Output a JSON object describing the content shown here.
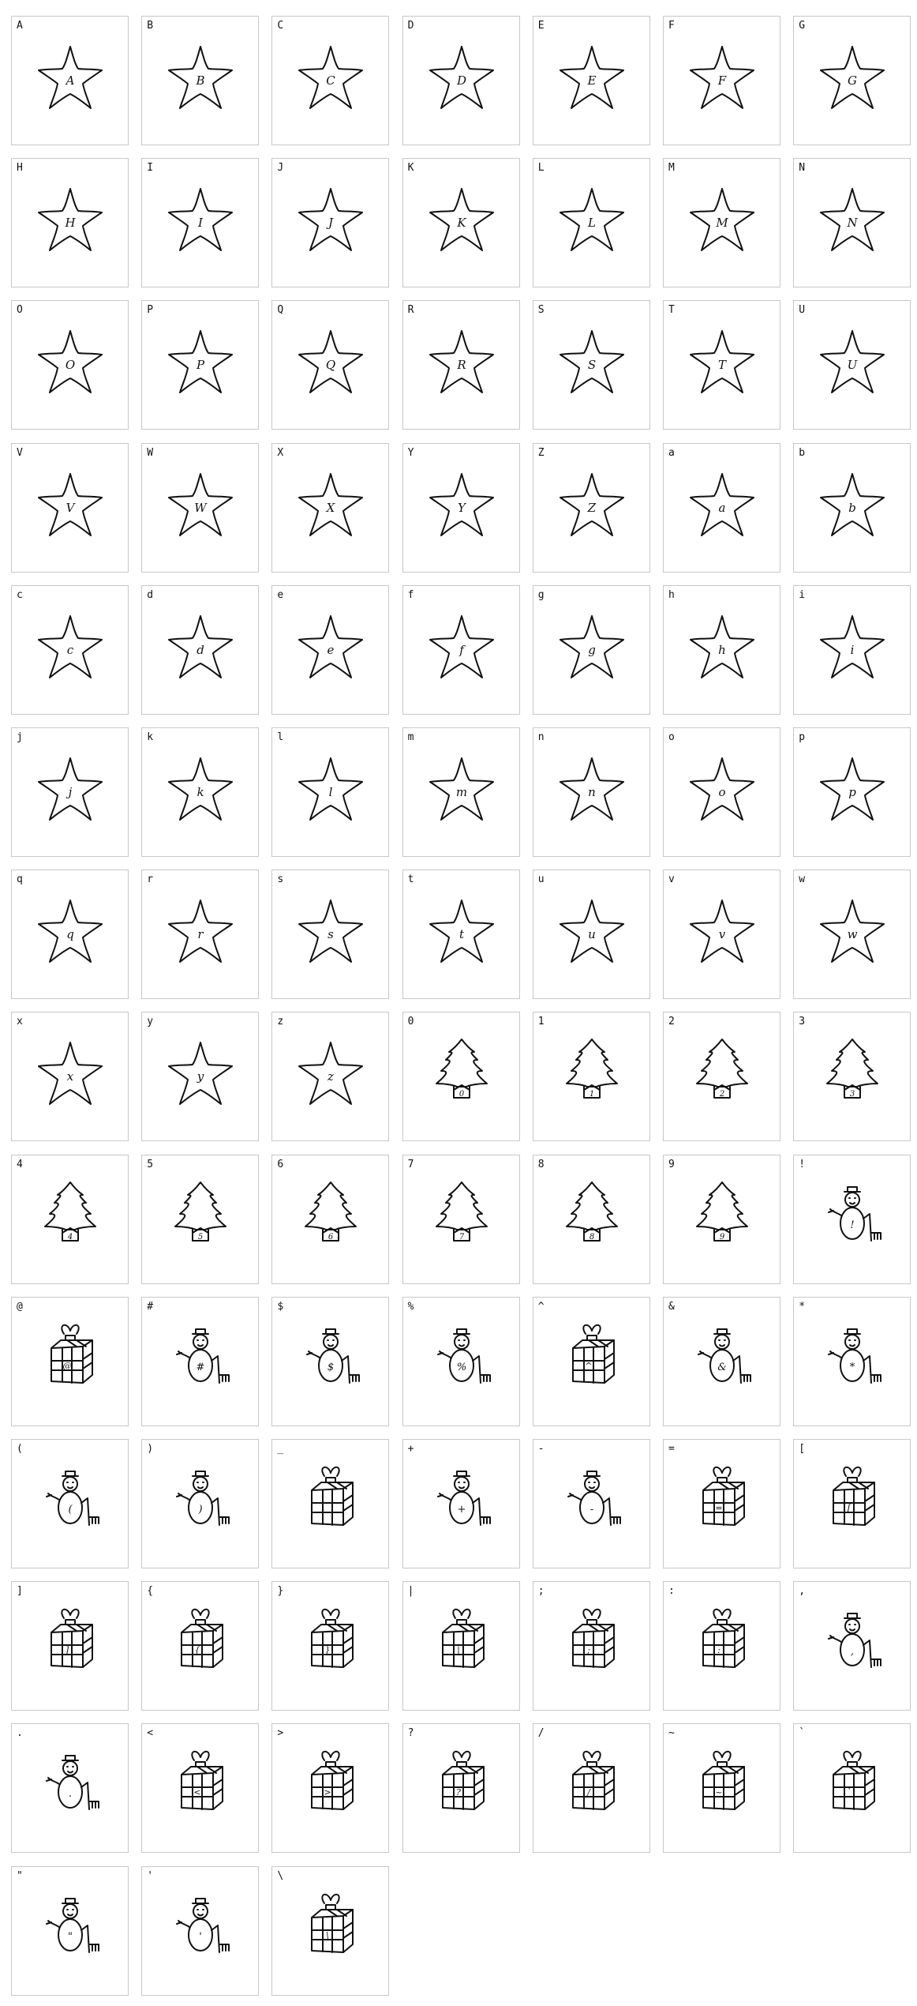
{
  "cells": [
    {
      "label": "A",
      "glyph": "star-icon"
    },
    {
      "label": "B",
      "glyph": "star-icon"
    },
    {
      "label": "C",
      "glyph": "star-icon"
    },
    {
      "label": "D",
      "glyph": "star-icon"
    },
    {
      "label": "E",
      "glyph": "star-icon"
    },
    {
      "label": "F",
      "glyph": "star-icon"
    },
    {
      "label": "G",
      "glyph": "star-icon"
    },
    {
      "label": "H",
      "glyph": "star-icon"
    },
    {
      "label": "I",
      "glyph": "star-icon"
    },
    {
      "label": "J",
      "glyph": "star-icon"
    },
    {
      "label": "K",
      "glyph": "star-icon"
    },
    {
      "label": "L",
      "glyph": "star-icon"
    },
    {
      "label": "M",
      "glyph": "star-icon"
    },
    {
      "label": "N",
      "glyph": "star-icon"
    },
    {
      "label": "O",
      "glyph": "star-icon"
    },
    {
      "label": "P",
      "glyph": "star-icon"
    },
    {
      "label": "Q",
      "glyph": "star-icon"
    },
    {
      "label": "R",
      "glyph": "star-icon"
    },
    {
      "label": "S",
      "glyph": "star-icon"
    },
    {
      "label": "T",
      "glyph": "star-icon"
    },
    {
      "label": "U",
      "glyph": "star-icon"
    },
    {
      "label": "V",
      "glyph": "star-icon"
    },
    {
      "label": "W",
      "glyph": "star-icon"
    },
    {
      "label": "X",
      "glyph": "star-icon"
    },
    {
      "label": "Y",
      "glyph": "star-icon"
    },
    {
      "label": "Z",
      "glyph": "star-icon"
    },
    {
      "label": "a",
      "glyph": "star-icon"
    },
    {
      "label": "b",
      "glyph": "star-icon"
    },
    {
      "label": "c",
      "glyph": "star-icon"
    },
    {
      "label": "d",
      "glyph": "star-icon"
    },
    {
      "label": "e",
      "glyph": "star-icon"
    },
    {
      "label": "f",
      "glyph": "star-icon"
    },
    {
      "label": "g",
      "glyph": "star-icon"
    },
    {
      "label": "h",
      "glyph": "star-icon"
    },
    {
      "label": "i",
      "glyph": "star-icon"
    },
    {
      "label": "j",
      "glyph": "star-icon"
    },
    {
      "label": "k",
      "glyph": "star-icon"
    },
    {
      "label": "l",
      "glyph": "star-icon"
    },
    {
      "label": "m",
      "glyph": "star-icon"
    },
    {
      "label": "n",
      "glyph": "star-icon"
    },
    {
      "label": "o",
      "glyph": "star-icon"
    },
    {
      "label": "p",
      "glyph": "star-icon"
    },
    {
      "label": "q",
      "glyph": "star-icon"
    },
    {
      "label": "r",
      "glyph": "star-icon"
    },
    {
      "label": "s",
      "glyph": "star-icon"
    },
    {
      "label": "t",
      "glyph": "star-icon"
    },
    {
      "label": "u",
      "glyph": "star-icon"
    },
    {
      "label": "v",
      "glyph": "star-icon"
    },
    {
      "label": "w",
      "glyph": "star-icon"
    },
    {
      "label": "x",
      "glyph": "star-icon"
    },
    {
      "label": "y",
      "glyph": "star-icon"
    },
    {
      "label": "z",
      "glyph": "star-icon"
    },
    {
      "label": "0",
      "glyph": "tree-icon"
    },
    {
      "label": "1",
      "glyph": "tree-icon"
    },
    {
      "label": "2",
      "glyph": "tree-icon"
    },
    {
      "label": "3",
      "glyph": "tree-icon"
    },
    {
      "label": "4",
      "glyph": "tree-icon"
    },
    {
      "label": "5",
      "glyph": "tree-icon"
    },
    {
      "label": "6",
      "glyph": "tree-icon"
    },
    {
      "label": "7",
      "glyph": "tree-icon"
    },
    {
      "label": "8",
      "glyph": "tree-icon"
    },
    {
      "label": "9",
      "glyph": "tree-icon"
    },
    {
      "label": "!",
      "glyph": "snowman-icon"
    },
    {
      "label": "@",
      "glyph": "gift-icon"
    },
    {
      "label": "#",
      "glyph": "snowman-icon"
    },
    {
      "label": "$",
      "glyph": "snowman-icon"
    },
    {
      "label": "%",
      "glyph": "snowman-icon"
    },
    {
      "label": "^",
      "glyph": "gift-icon"
    },
    {
      "label": "&",
      "glyph": "snowman-icon"
    },
    {
      "label": "*",
      "glyph": "snowman-icon"
    },
    {
      "label": "(",
      "glyph": "snowman-icon"
    },
    {
      "label": ")",
      "glyph": "snowman-icon"
    },
    {
      "label": "_",
      "glyph": "gift-icon"
    },
    {
      "label": "+",
      "glyph": "snowman-icon"
    },
    {
      "label": "-",
      "glyph": "snowman-icon"
    },
    {
      "label": "=",
      "glyph": "gift-icon"
    },
    {
      "label": "[",
      "glyph": "gift-icon"
    },
    {
      "label": "]",
      "glyph": "gift-icon"
    },
    {
      "label": "{",
      "glyph": "gift-icon"
    },
    {
      "label": "}",
      "glyph": "gift-icon"
    },
    {
      "label": "|",
      "glyph": "gift-icon"
    },
    {
      "label": ";",
      "glyph": "gift-icon"
    },
    {
      "label": ":",
      "glyph": "gift-icon"
    },
    {
      "label": ",",
      "glyph": "snowman-icon"
    },
    {
      "label": ".",
      "glyph": "snowman-icon"
    },
    {
      "label": "<",
      "glyph": "gift-icon"
    },
    {
      "label": ">",
      "glyph": "gift-icon"
    },
    {
      "label": "?",
      "glyph": "gift-icon"
    },
    {
      "label": "/",
      "glyph": "gift-icon"
    },
    {
      "label": "~",
      "glyph": "gift-icon"
    },
    {
      "label": "`",
      "glyph": "gift-icon"
    },
    {
      "label": "\"",
      "glyph": "snowman-icon"
    },
    {
      "label": "'",
      "glyph": "snowman-icon"
    },
    {
      "label": "\\",
      "glyph": "gift-icon"
    }
  ]
}
